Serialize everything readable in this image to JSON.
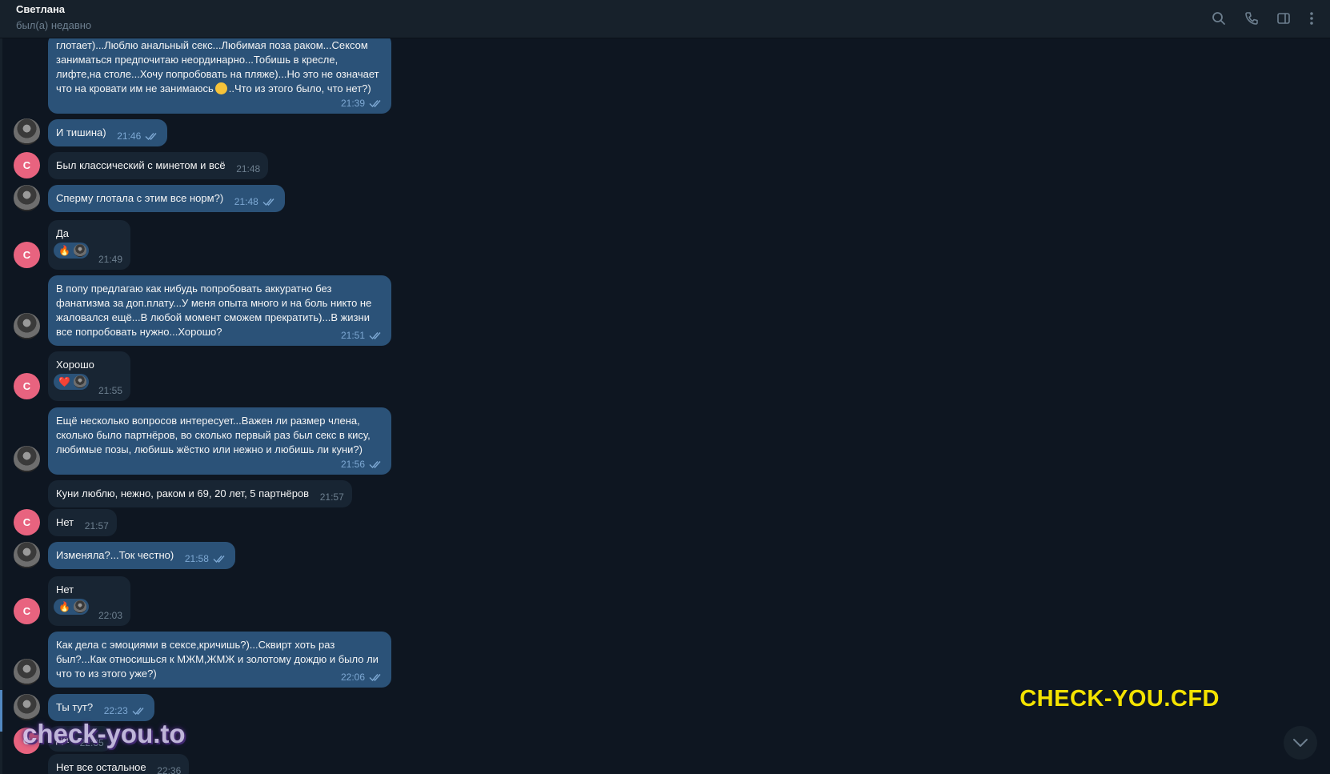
{
  "header": {
    "name": "Светлана",
    "status": "был(а) недавно",
    "icons": [
      "search-icon",
      "phone-icon",
      "sidebar-toggle-icon",
      "more-vertical-icon"
    ]
  },
  "avatars": {
    "contact_letter": "С"
  },
  "messages": [
    {
      "dir": "out",
      "text": "глотает)...Люблю анальный секс...Любимая поза раком...Сексом заниматься предпочитаю неординарно...Тобишь в кресле, лифте,на столе...Хочу попробовать на пляже)...Но это не означает что на кровати им не занимаюсь",
      "text_after_emoji": "..Что из этого было, что нет?)",
      "time": "21:39"
    },
    {
      "dir": "out",
      "text": "И тишина)",
      "time": "21:46"
    },
    {
      "dir": "in",
      "text": "Был классический с минетом и всё",
      "time": "21:48"
    },
    {
      "dir": "out",
      "text": "Сперму глотала с этим все норм?)",
      "time": "21:48"
    },
    {
      "dir": "in",
      "text": "Да",
      "time": "21:49",
      "reaction": "🔥"
    },
    {
      "dir": "out",
      "text": "В попу предлагаю как нибудь попробовать аккуратно без фанатизма за доп.плату...У меня опыта много и на боль никто не жаловался ещё...В любой момент сможем прекратить)...В жизни все попробовать нужно...Хорошо?",
      "time": "21:51"
    },
    {
      "dir": "in",
      "text": "Хорошо",
      "time": "21:55",
      "reaction": "❤️"
    },
    {
      "dir": "out",
      "text": "Ещё несколько вопросов интересует...Важен ли размер члена, сколько было партнёров, во сколько первый раз был секс в кису, любимые позы, любишь жёстко или нежно и любишь ли куни?)",
      "time": "21:56"
    },
    {
      "dir": "in",
      "text": "Куни люблю, нежно, раком и 69, 20 лет, 5 партнёров",
      "time": "21:57"
    },
    {
      "dir": "in",
      "text": "Нет",
      "time": "21:57"
    },
    {
      "dir": "out",
      "text": "Изменяла?...Ток честно)",
      "time": "21:58"
    },
    {
      "dir": "in",
      "text": "Нет",
      "time": "22:03",
      "reaction": "🔥"
    },
    {
      "dir": "out",
      "text": "Как дела с эмоциями в сексе,кричишь?)...Сквирт хоть раз был?...Как относишься к МЖМ,ЖМЖ и золотому дождю и было ли что то из этого уже?)",
      "time": "22:06"
    },
    {
      "dir": "out",
      "text": "Ты тут?",
      "time": "22:23"
    },
    {
      "dir": "in",
      "text": "Да",
      "time": "22:35"
    },
    {
      "dir": "in",
      "text": "Нет все остальное",
      "time": "22:36"
    }
  ],
  "watermarks": {
    "left": "check-you.to",
    "right": "CHECK-YOU.CFD"
  },
  "colors": {
    "background": "#0e1621",
    "header": "#17212b",
    "outgoing_bubble": "#2b5278",
    "incoming_bubble": "#182533",
    "avatar_letter_bg": "#e8637f",
    "watermark_right": "#f4e300"
  }
}
